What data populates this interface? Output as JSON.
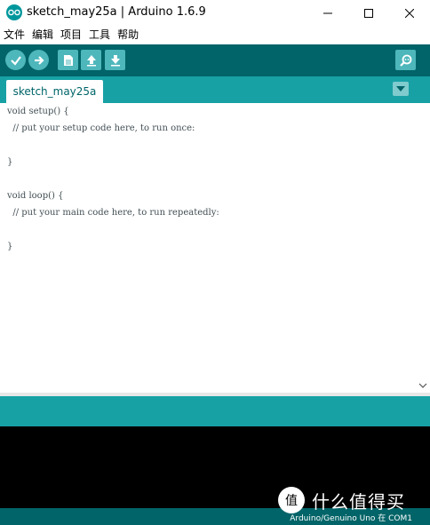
{
  "window": {
    "title": "sketch_may25a | Arduino 1.6.9"
  },
  "menu": {
    "items": [
      "文件",
      "编辑",
      "项目",
      "工具",
      "帮助"
    ]
  },
  "toolbar": {
    "buttons": [
      "verify-icon",
      "upload-icon",
      "new-icon",
      "open-icon",
      "save-icon"
    ],
    "serial_monitor": "serial-monitor-icon"
  },
  "tabs": [
    {
      "label": "sketch_may25a"
    }
  ],
  "editor": {
    "lines": [
      "void setup() {",
      "  // put your setup code here, to run once:",
      "",
      "}",
      "",
      "void loop() {",
      "  // put your main code here, to run repeatedly:",
      "",
      "}"
    ]
  },
  "footer": {
    "board": "Arduino/Genuino Uno 在 COM1"
  },
  "watermark": {
    "text": "什么值得买",
    "badge": "值"
  },
  "colors": {
    "toolbar": "#006468",
    "tabstrip": "#17a1a5",
    "button": "#4db7bb",
    "console": "#000000"
  }
}
